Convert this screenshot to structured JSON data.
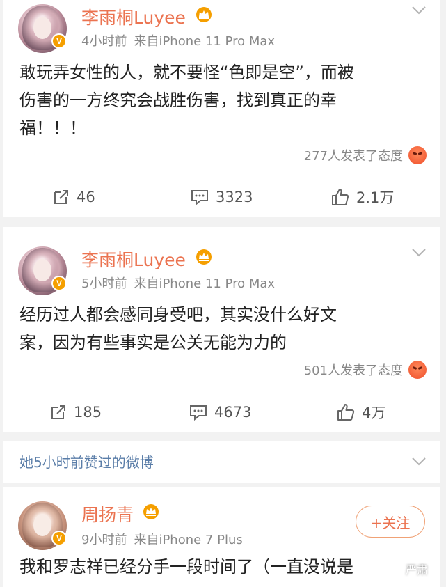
{
  "posts": [
    {
      "author": "李雨桐Luyee",
      "time": "4小时前",
      "source": "来自iPhone 11 Pro Max",
      "content_lines": [
        "敢玩弄女性的人，就不要怪“色即是空”，而被",
        "伤害的一方终究会战胜伤害，找到真正的幸",
        "福！！！"
      ],
      "reactions": "277人发表了态度",
      "reposts": "46",
      "comments": "3323",
      "likes": "2.1万"
    },
    {
      "author": "李雨桐Luyee",
      "time": "5小时前",
      "source": "来自iPhone 11 Pro Max",
      "content_lines": [
        "经历过人都会感同身受吧，其实没什么好文",
        "案，因为有些事实是公关无能为力的"
      ],
      "reactions": "501人发表了态度",
      "reposts": "185",
      "comments": "4673",
      "likes": "4万"
    }
  ],
  "liked_section": {
    "header": "她5小时前赞过的微博",
    "author": "周扬青",
    "time": "9小时前",
    "source": "来自iPhone 7 Plus",
    "follow_label": "+关注",
    "content_line": "我和罗志祥已经分手一段时间了（一直没说是"
  },
  "watermark": "严肃",
  "colors": {
    "accent": "#eb7350",
    "link": "#5a7da8",
    "vip_gold": "#f59f00"
  }
}
